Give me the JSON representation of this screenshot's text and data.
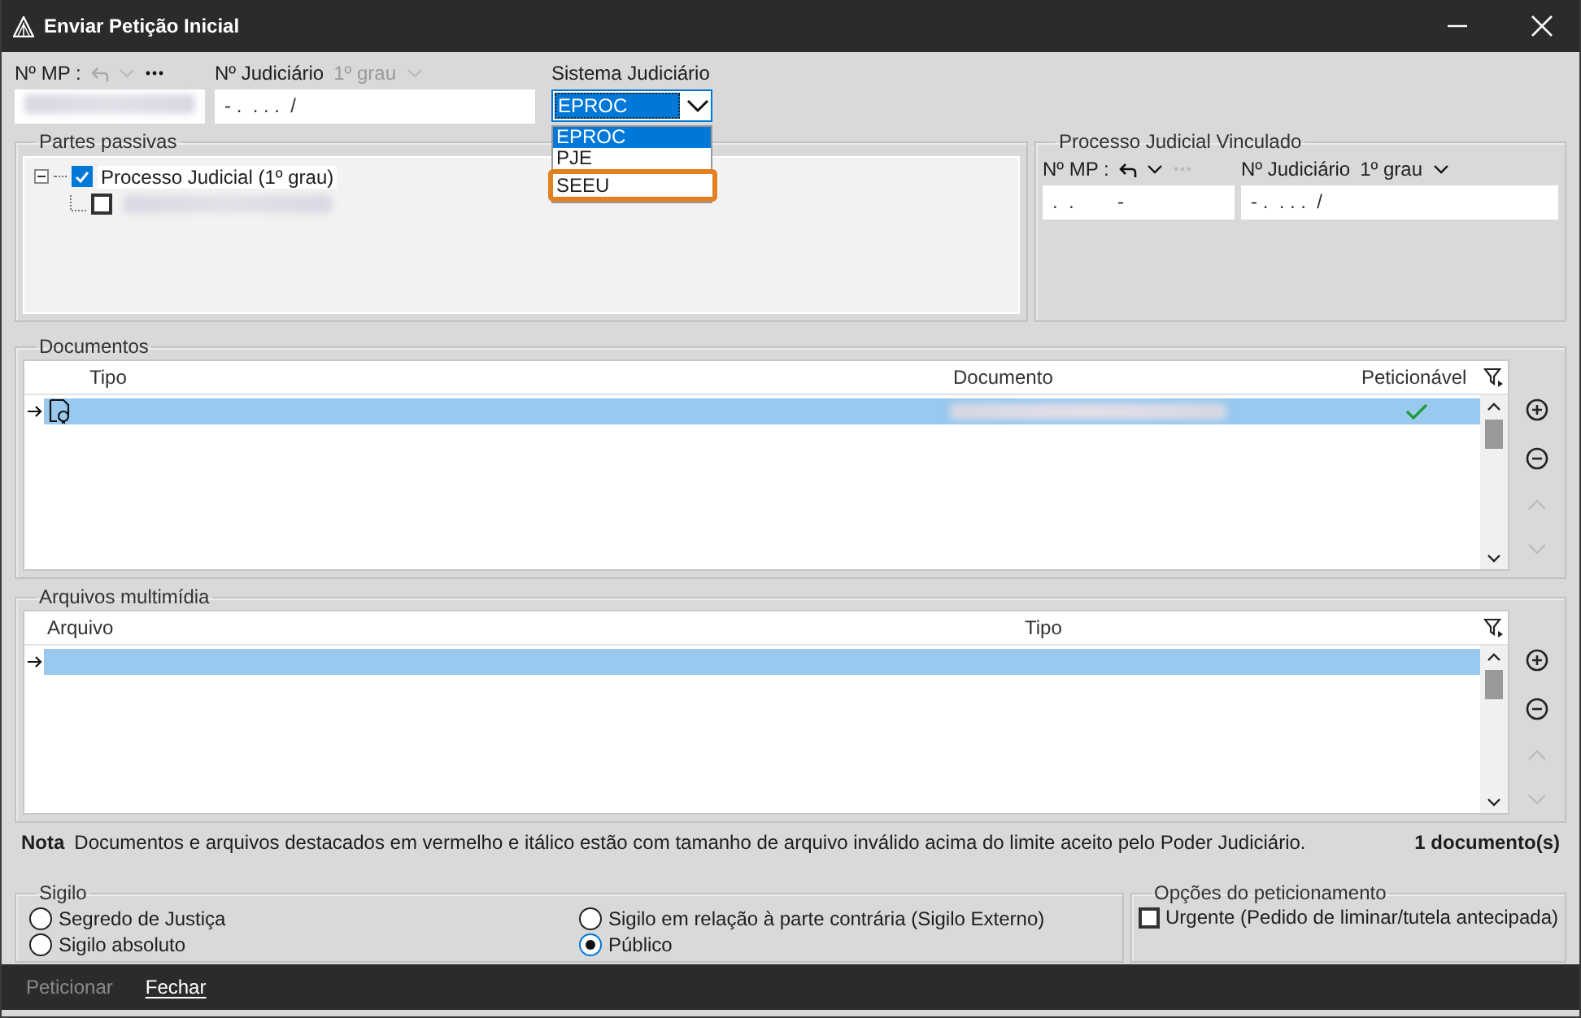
{
  "window": {
    "title": "Enviar Petição Inicial"
  },
  "header": {
    "mp": {
      "label": "Nº MP :"
    },
    "judiciario": {
      "label": "Nº Judiciário",
      "grau": "1º grau",
      "disabled": true,
      "value": "- .  . . .  /"
    },
    "sistema": {
      "label": "Sistema Judiciário",
      "value": "EPROC",
      "expanded": true,
      "options": [
        {
          "label": "EPROC",
          "selected": true,
          "highlighted": false
        },
        {
          "label": "PJE",
          "selected": false,
          "highlighted": false
        },
        {
          "label": "SEEU",
          "selected": false,
          "highlighted": true
        }
      ]
    }
  },
  "partes_passivas": {
    "title": "Partes passivas",
    "tree": [
      {
        "label": "Processo Judicial (1º grau)",
        "checked": true,
        "expanded": true,
        "children": [
          {
            "checked": false
          }
        ]
      }
    ]
  },
  "processo_vinculado": {
    "title": "Processo Judicial Vinculado",
    "mp": {
      "label": "Nº MP :",
      "value": ".  .        -"
    },
    "judiciario": {
      "label": "Nº Judiciário",
      "grau": "1º grau",
      "disabled": false,
      "value": "- .  . . .  /"
    }
  },
  "documentos": {
    "title": "Documentos",
    "columns": [
      "Tipo",
      "Documento",
      "Peticionável"
    ],
    "rows": [
      {
        "selected": true,
        "peticionavel": true
      }
    ]
  },
  "multimidia": {
    "title": "Arquivos multimídia",
    "columns": [
      "Arquivo",
      "Tipo"
    ],
    "rows": [
      {
        "selected": true
      }
    ]
  },
  "nota": {
    "label": "Nota",
    "text": "Documentos e arquivos destacados em vermelho e itálico estão com tamanho de arquivo inválido acima do limite aceito pelo Poder Judiciário.",
    "count": "1 documento(s)"
  },
  "sigilo": {
    "title": "Sigilo",
    "options": [
      {
        "label": "Segredo de Justiça",
        "selected": false
      },
      {
        "label": "Sigilo absoluto",
        "selected": false
      },
      {
        "label": "Sigilo em relação à parte contrária (Sigilo Externo)",
        "selected": false
      },
      {
        "label": "Público",
        "selected": true
      }
    ]
  },
  "opcoes": {
    "title": "Opções do peticionamento",
    "options": [
      {
        "label": "Urgente (Pedido de liminar/tutela antecipada)",
        "checked": false
      }
    ]
  },
  "footer": {
    "buttons": [
      {
        "label": "Peticionar",
        "disabled": true
      },
      {
        "label": "Fechar",
        "disabled": false
      }
    ]
  }
}
